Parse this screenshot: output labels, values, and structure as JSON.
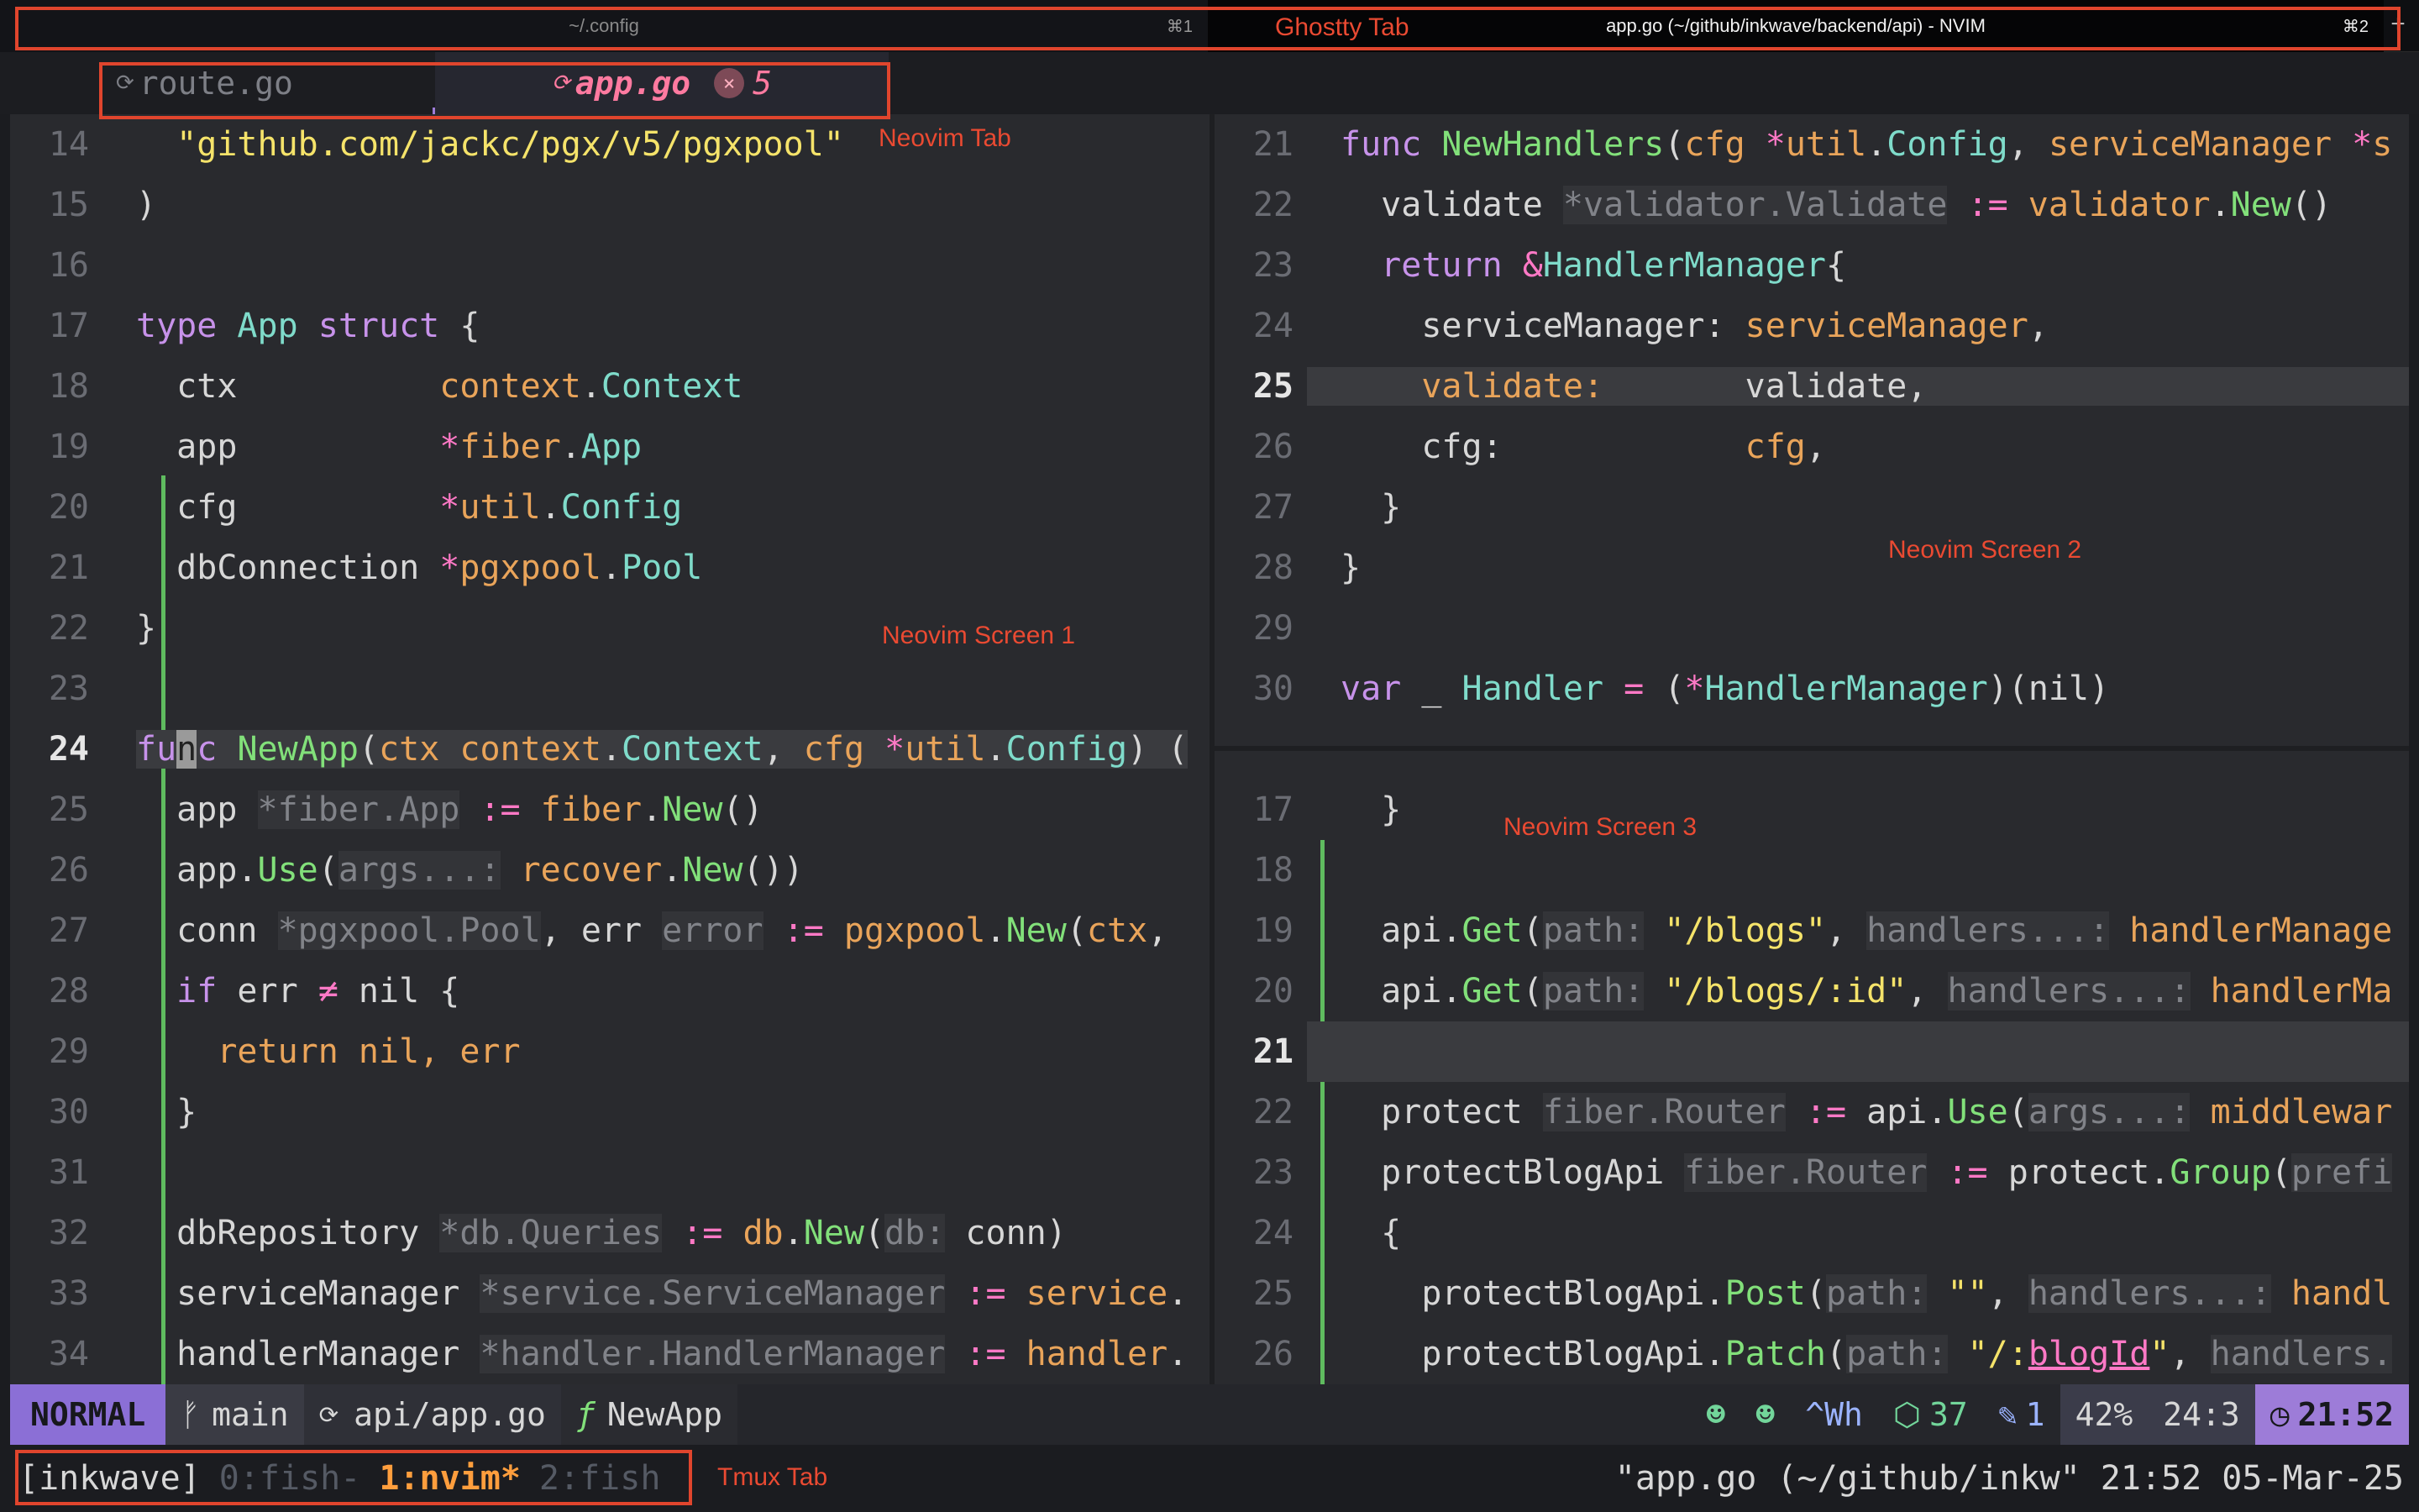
{
  "ghostty": {
    "tab1_title": "~/.config",
    "tab1_shortcut": "⌘1",
    "tab2_title": "app.go (~/github/inkwave/backend/api) - NVIM",
    "tab2_shortcut": "⌘2",
    "new_tab": "+"
  },
  "annotations": {
    "ghostty_tab": "Ghostty Tab",
    "neovim_tab": "Neovim Tab",
    "screen1": "Neovim Screen 1",
    "screen2": "Neovim Screen 2",
    "screen3": "Neovim Screen 3",
    "tmux_tab": "Tmux Tab"
  },
  "tabline": {
    "tab1": {
      "icon": "go-icon",
      "label": "route.go"
    },
    "tab2": {
      "icon": "go-icon",
      "label": "app.go",
      "error_icon": "error-circle-icon",
      "error_count": "5"
    }
  },
  "pane1": {
    "lines": [
      {
        "n": "14",
        "text": "  \"github.com/jackc/pgx/v5/pgxpool\""
      },
      {
        "n": "15",
        "text": ")"
      },
      {
        "n": "16",
        "text": ""
      },
      {
        "n": "17",
        "text": "type App struct {"
      },
      {
        "n": "18",
        "text": "  ctx          context.Context"
      },
      {
        "n": "19",
        "text": "  app          *fiber.App"
      },
      {
        "n": "20",
        "text": "  cfg          *util.Config"
      },
      {
        "n": "21",
        "text": "  dbConnection *pgxpool.Pool"
      },
      {
        "n": "22",
        "text": "}"
      },
      {
        "n": "23",
        "text": ""
      },
      {
        "n": "24",
        "text": "func NewApp(ctx context.Context, cfg *util.Config) ("
      },
      {
        "n": "25",
        "text": "  app *fiber.App := fiber.New()"
      },
      {
        "n": "26",
        "text": "  app.Use(args...: recover.New())"
      },
      {
        "n": "27",
        "text": "  conn *pgxpool.Pool, err error := pgxpool.New(ctx,"
      },
      {
        "n": "28",
        "text": "  if err ≠ nil {"
      },
      {
        "n": "29",
        "text": "    return nil, err"
      },
      {
        "n": "30",
        "text": "  }"
      },
      {
        "n": "31",
        "text": ""
      },
      {
        "n": "32",
        "text": "  dbRepository *db.Queries := db.New(db: conn)"
      },
      {
        "n": "33",
        "text": "  serviceManager *service.ServiceManager := service."
      },
      {
        "n": "34",
        "text": "  handlerManager *handler.HandlerManager := handler."
      }
    ]
  },
  "pane2": {
    "lines": [
      {
        "n": "21",
        "text": "func NewHandlers(cfg *util.Config, serviceManager *s"
      },
      {
        "n": "22",
        "text": "  validate *validator.Validate := validator.New()"
      },
      {
        "n": "23",
        "text": "  return &HandlerManager{"
      },
      {
        "n": "24",
        "text": "    serviceManager: serviceManager,"
      },
      {
        "n": "25",
        "text": "    validate:       validate,"
      },
      {
        "n": "26",
        "text": "    cfg:            cfg,"
      },
      {
        "n": "27",
        "text": "  }"
      },
      {
        "n": "28",
        "text": "}"
      },
      {
        "n": "29",
        "text": ""
      },
      {
        "n": "30",
        "text": "var _ Handler = (*HandlerManager)(nil)"
      }
    ]
  },
  "pane3": {
    "lines": [
      {
        "n": "17",
        "text": "  }"
      },
      {
        "n": "18",
        "text": ""
      },
      {
        "n": "19",
        "text": "  api.Get(path: \"/blogs\", handlers...: handlerManage"
      },
      {
        "n": "20",
        "text": "  api.Get(path: \"/blogs/:id\", handlers...: handlerMa"
      },
      {
        "n": "21",
        "text": ""
      },
      {
        "n": "22",
        "text": "  protect fiber.Router := api.Use(args...: middlewar"
      },
      {
        "n": "23",
        "text": "  protectBlogApi fiber.Router := protect.Group(prefi"
      },
      {
        "n": "24",
        "text": "  {"
      },
      {
        "n": "25",
        "text": "    protectBlogApi.Post(path: \"\", handlers...: handl"
      },
      {
        "n": "26",
        "text": "    protectBlogApi.Patch(path: \"/:blogId\", handlers."
      }
    ]
  },
  "statusline": {
    "mode": "NORMAL",
    "branch_icon": "git-branch-icon",
    "branch": "main",
    "file_icon": "go-icon",
    "file": "api/app.go",
    "func_icon": "function-icon",
    "func": "NewApp",
    "copilot_icon_1": "copilot-icon",
    "copilot_icon_2": "copilot-icon",
    "keys": "^Wh",
    "lsp_icon": "package-icon",
    "lsp_count": "37",
    "edit_icon": "edit-icon",
    "edit_count": "1",
    "percent": "42%",
    "position": "24:3",
    "clock_icon": "clock-icon",
    "time": "21:52"
  },
  "tmux": {
    "session": "[inkwave]",
    "windows": [
      "0:fish-",
      "1:nvim*",
      "2:fish"
    ],
    "right": "\"app.go (~/github/inkw\" 21:52 05-Mar-25"
  }
}
